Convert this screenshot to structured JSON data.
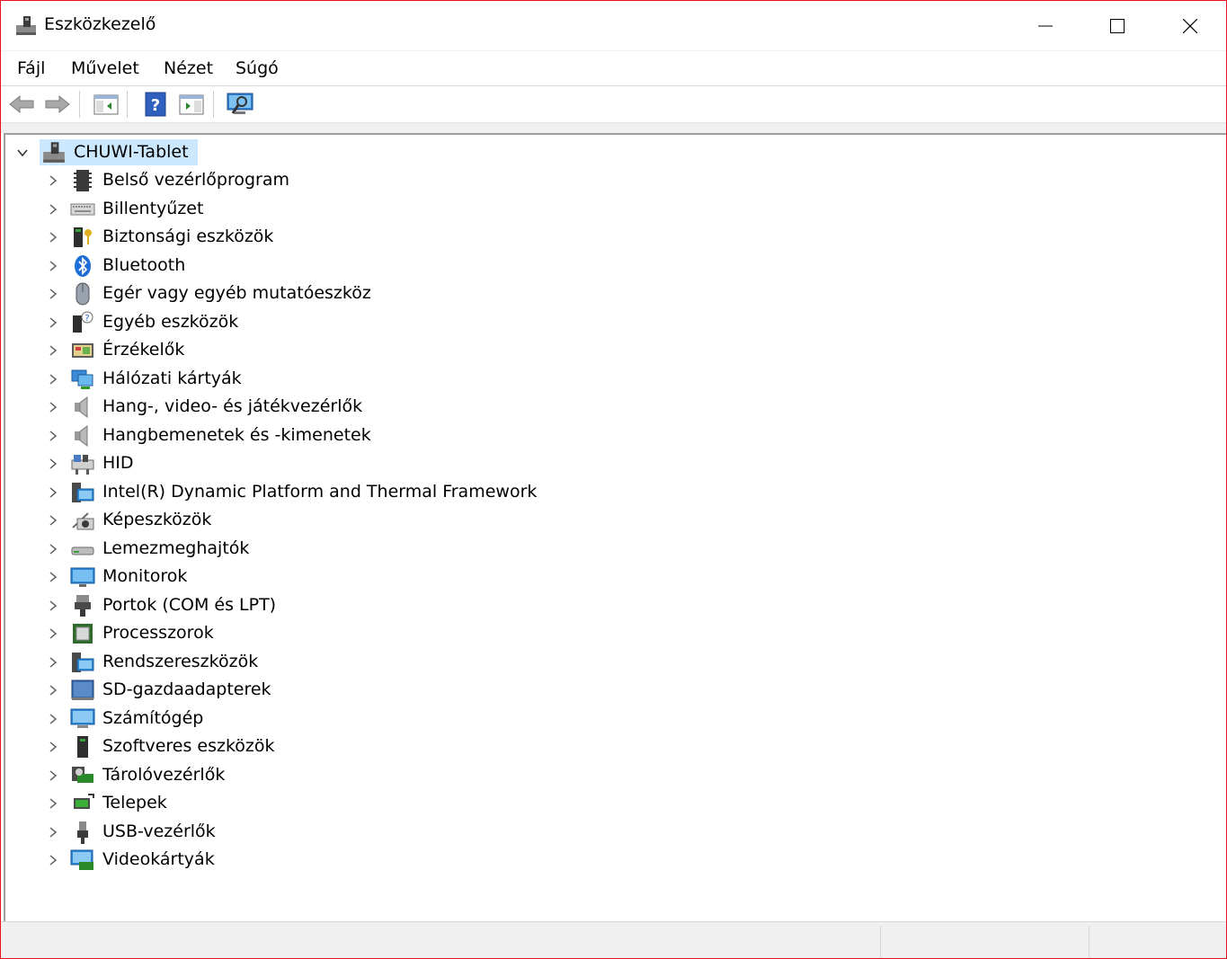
{
  "window": {
    "title": "Eszközkezelő"
  },
  "menu": [
    "Fájl",
    "Művelet",
    "Nézet",
    "Súgó"
  ],
  "toolbar": [
    "back-arrow-icon",
    "forward-arrow-icon",
    "show-hide-console-tree-icon",
    "help-icon",
    "show-action-pane-icon",
    "scan-hardware-icon"
  ],
  "tree": {
    "root": "CHUWI-Tablet",
    "items": [
      {
        "label": "Belső vezérlőprogram",
        "icon": "firmware-chip-icon"
      },
      {
        "label": "Billentyűzet",
        "icon": "keyboard-icon"
      },
      {
        "label": "Biztonsági eszközök",
        "icon": "security-key-icon"
      },
      {
        "label": "Bluetooth",
        "icon": "bluetooth-icon"
      },
      {
        "label": "Egér vagy egyéb mutatóeszköz",
        "icon": "mouse-icon"
      },
      {
        "label": "Egyéb eszközök",
        "icon": "unknown-device-icon"
      },
      {
        "label": "Érzékelők",
        "icon": "sensor-icon"
      },
      {
        "label": "Hálózati kártyák",
        "icon": "network-adapter-icon"
      },
      {
        "label": "Hang-, video- és játékvezérlők",
        "icon": "speaker-icon"
      },
      {
        "label": "Hangbemenetek és -kimenetek",
        "icon": "speaker-icon"
      },
      {
        "label": "HID",
        "icon": "hid-icon"
      },
      {
        "label": "Intel(R) Dynamic Platform and Thermal Framework",
        "icon": "system-device-icon"
      },
      {
        "label": "Képeszközök",
        "icon": "camera-icon"
      },
      {
        "label": "Lemezmeghajtók",
        "icon": "disk-drive-icon"
      },
      {
        "label": "Monitorok",
        "icon": "monitor-icon"
      },
      {
        "label": "Portok (COM és LPT)",
        "icon": "port-icon"
      },
      {
        "label": "Processzorok",
        "icon": "processor-icon"
      },
      {
        "label": "Rendszereszközök",
        "icon": "system-device-icon"
      },
      {
        "label": "SD-gazdaadapterek",
        "icon": "sd-adapter-icon"
      },
      {
        "label": "Számítógép",
        "icon": "computer-icon"
      },
      {
        "label": "Szoftveres eszközök",
        "icon": "software-device-icon"
      },
      {
        "label": "Tárolóvezérlők",
        "icon": "storage-controller-icon"
      },
      {
        "label": "Telepek",
        "icon": "battery-icon"
      },
      {
        "label": "USB-vezérlők",
        "icon": "usb-icon"
      },
      {
        "label": "Videokártyák",
        "icon": "display-adapter-icon"
      }
    ]
  }
}
